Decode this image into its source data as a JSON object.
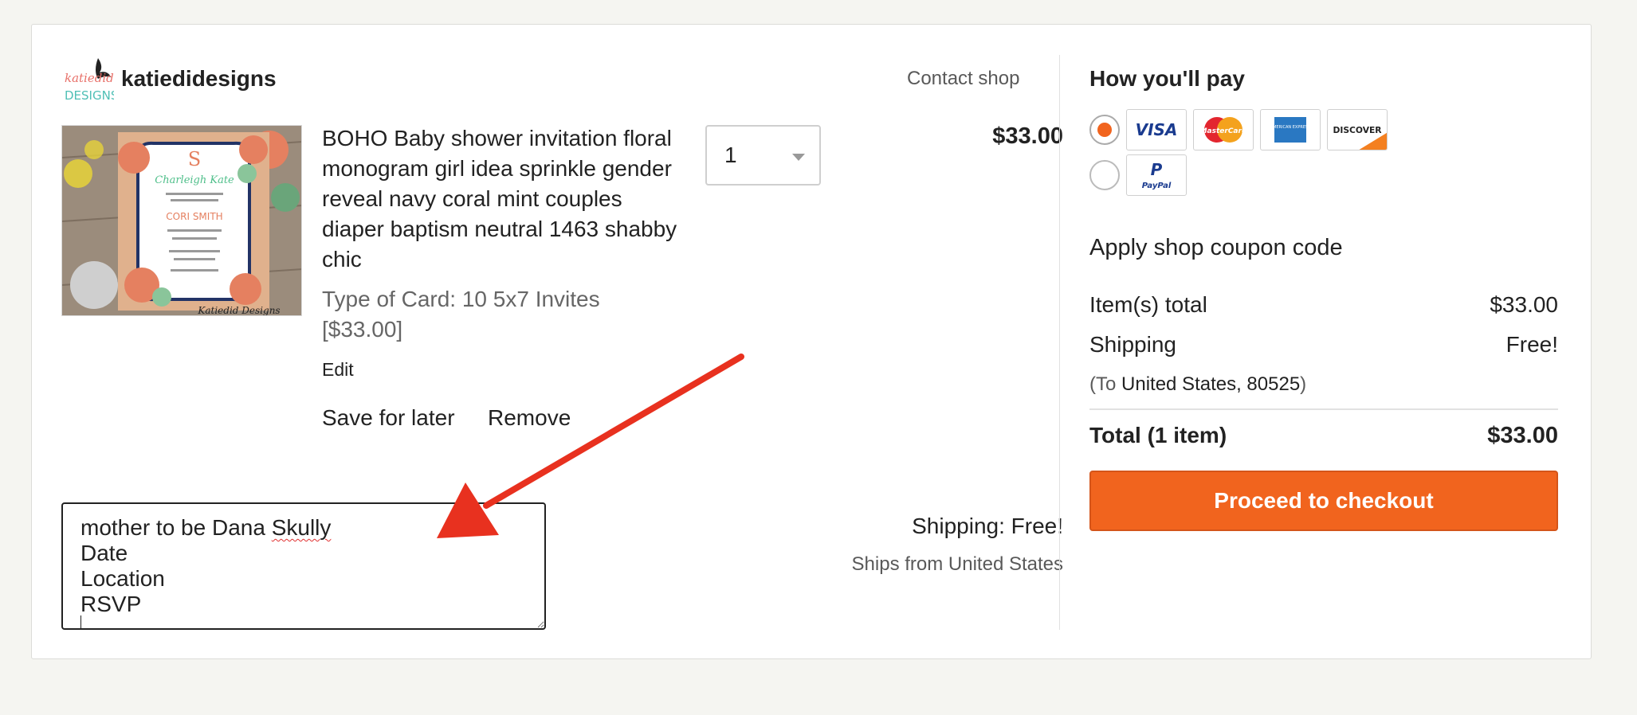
{
  "shop": {
    "name": "katiedidesigns",
    "logo_text_top": "katiedid",
    "logo_text_bottom": "DESIGNS",
    "contact_label": "Contact shop"
  },
  "listing": {
    "title": "BOHO Baby shower invitation floral monogram girl idea sprinkle gender reveal navy coral mint couples diaper baptism neutral 1463 shabby chic",
    "variation": "Type of Card: 10 5x7 Invites [$33.00]",
    "edit_label": "Edit",
    "save_for_later_label": "Save for later",
    "remove_label": "Remove",
    "quantity": "1",
    "price": "$33.00",
    "thumbnail_text": {
      "name": "Charleigh Kate",
      "guest": "CORI SMITH",
      "watermark": "Katiedid Designs"
    }
  },
  "note": {
    "lines": [
      "mother to be Dana",
      "Skully",
      "Date",
      "Location",
      "RSVP"
    ]
  },
  "shipping": {
    "label": "Shipping: Free!",
    "ships_from": "Ships from United States"
  },
  "payment": {
    "title": "How you'll pay",
    "cards": [
      "VISA",
      "MasterCard",
      "AMERICAN EXPRESS",
      "DISCOVER"
    ],
    "paypal": "PayPal"
  },
  "summary": {
    "coupon_label": "Apply shop coupon code",
    "items_total_label": "Item(s) total",
    "items_total_value": "$33.00",
    "shipping_label": "Shipping",
    "shipping_value": "Free!",
    "ship_to_prefix": "(To ",
    "ship_to_value": "United States, 80525",
    "ship_to_suffix": ")",
    "total_label": "Total (1 item)",
    "total_value": "$33.00",
    "checkout_label": "Proceed to checkout"
  },
  "colors": {
    "accent": "#f1641e",
    "annotation_arrow": "#e8311f"
  }
}
